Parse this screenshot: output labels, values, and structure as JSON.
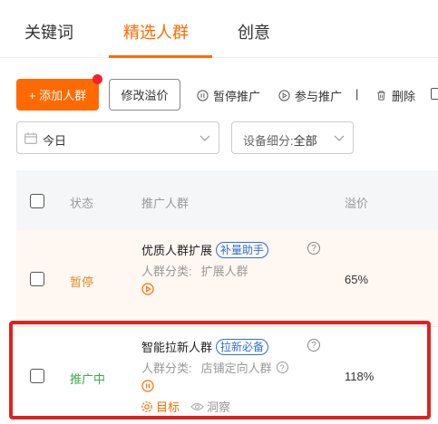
{
  "tabs": [
    {
      "label": "关键词",
      "active": false
    },
    {
      "label": "精选人群",
      "active": true
    },
    {
      "label": "创意",
      "active": false
    }
  ],
  "toolbar": {
    "add_label": "+ 添加人群",
    "edit_label": "修改溢价",
    "pause_label": "暂停推广",
    "join_label": "参与推广",
    "separator": "|",
    "delete_label": "删除"
  },
  "filters": {
    "date_value": "今日",
    "device_label": "设备细分:",
    "device_value": "全部"
  },
  "table": {
    "headers": {
      "status": "状态",
      "crowd": "推广人群",
      "premium": "溢价"
    },
    "rows": [
      {
        "status": "暂停",
        "status_color": "#e58a1f",
        "name": "优质人群扩展",
        "badge": "补量助手",
        "category_label": "人群分类:",
        "category_value": "扩展人群",
        "premium": "65%",
        "action_icon": "play-circle-icon"
      },
      {
        "status": "推广中",
        "status_color": "#3aaa4a",
        "name": "智能拉新人群",
        "badge": "拉新必备",
        "category_label": "人群分类:",
        "category_value": "店铺定向人群",
        "premium": "118%",
        "action_icon": "pause-circle-icon",
        "target_label": "目标",
        "insight_label": "洞察"
      }
    ]
  },
  "colors": {
    "accent": "#ff6a00",
    "badge_blue": "#2f6fd8",
    "highlight_red": "#e0221c"
  }
}
